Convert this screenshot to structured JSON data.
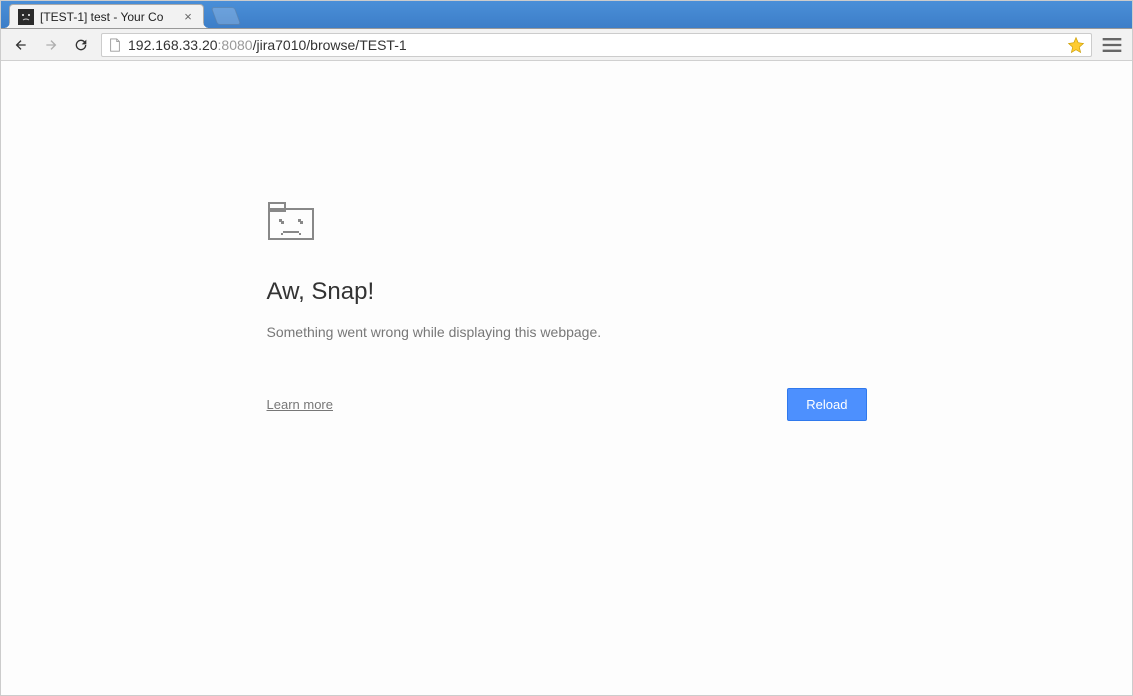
{
  "browser": {
    "tab_title": "[TEST-1] test - Your Co",
    "url_host": "192.168.33.20",
    "url_port": ":8080",
    "url_path": "/jira7010/browse/TEST-1"
  },
  "error": {
    "title": "Aw, Snap!",
    "message": "Something went wrong while displaying this webpage.",
    "learn_more": "Learn more",
    "reload": "Reload"
  }
}
